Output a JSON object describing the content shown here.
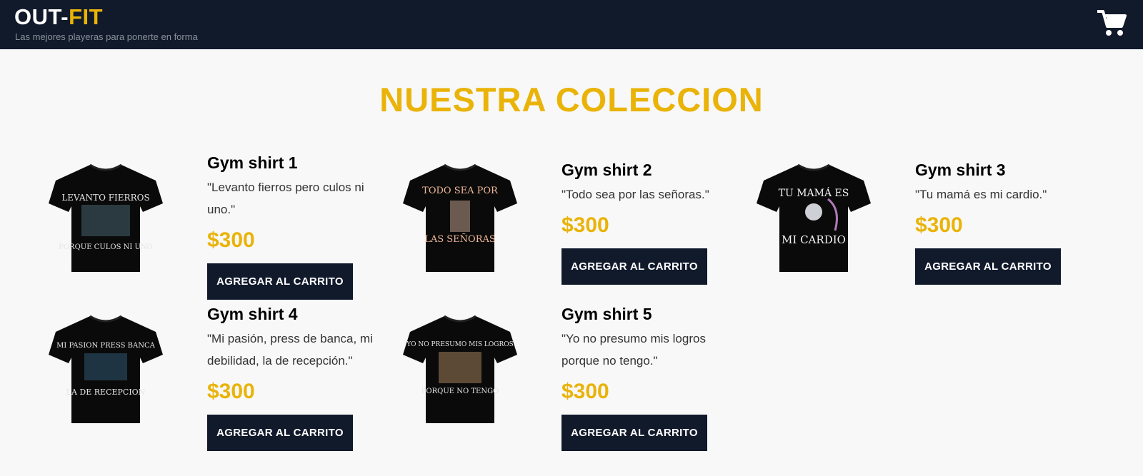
{
  "header": {
    "logo_part1": "OUT-",
    "logo_part2": "FIT",
    "tagline": "Las mejores playeras para ponerte en forma",
    "cart_icon": "shopping-cart-icon"
  },
  "main": {
    "title": "NUESTRA COLECCION"
  },
  "products": [
    {
      "name": "Gym shirt 1",
      "quote": "\"Levanto fierros pero culos ni uno.\"",
      "price": "$300",
      "button": "AGREGAR AL CARRITO",
      "print_top": "LEVANTO FIERROS",
      "print_bottom": "PORQUE CULOS NI UNO"
    },
    {
      "name": "Gym shirt 2",
      "quote": "\"Todo sea por las señoras.\"",
      "price": "$300",
      "button": "AGREGAR AL CARRITO",
      "print_top": "TODO SEA POR",
      "print_bottom": "LAS SEÑORAS"
    },
    {
      "name": "Gym shirt 3",
      "quote": "\"Tu mamá es mi cardio.\"",
      "price": "$300",
      "button": "AGREGAR AL CARRITO",
      "print_top": "TU MAMÁ ES",
      "print_bottom": "MI CARDIO"
    },
    {
      "name": "Gym shirt 4",
      "quote": "\"Mi pasión, press de banca, mi debilidad, la de recepción.\"",
      "price": "$300",
      "button": "AGREGAR AL CARRITO",
      "print_top": "MI PASION PRESS BANCA",
      "print_bottom": "LA DE RECEPCION"
    },
    {
      "name": "Gym shirt 5",
      "quote": "\"Yo no presumo mis logros porque no tengo.\"",
      "price": "$300",
      "button": "AGREGAR AL CARRITO",
      "print_top": "YO NO PRESUMO MIS LOGROS",
      "print_bottom": "PORQUE NO TENGO"
    }
  ],
  "colors": {
    "navy": "#111a2b",
    "accent": "#eab308",
    "background": "#f8f8f8"
  }
}
